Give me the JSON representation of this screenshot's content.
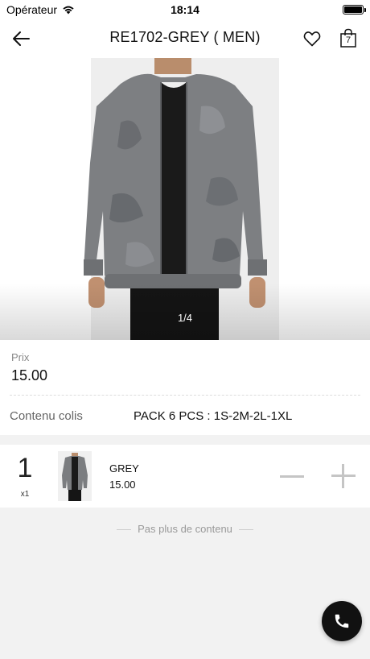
{
  "status_bar": {
    "carrier": "Opérateur",
    "time": "18:14"
  },
  "nav": {
    "title": "RE1702-GREY ( MEN)",
    "cart_count": "7"
  },
  "gallery": {
    "pager": "1/4"
  },
  "product": {
    "price_label": "Prix",
    "price": "15.00",
    "contents_label": "Contenu colis",
    "contents_value": "PACK 6 PCS : 1S-2M-2L-1XL"
  },
  "cart_item": {
    "quantity": "1",
    "multiplier": "x1",
    "color": "GREY",
    "price": "15.00"
  },
  "footer": {
    "end_text": "Pas plus de contenu"
  },
  "colors": {
    "background": "#f2f2f2",
    "fab": "#111111",
    "stepper": "#c5c5c5"
  },
  "icons": {
    "back": "arrow-left-icon",
    "favorite": "heart-icon",
    "cart": "shopping-bag-icon",
    "call": "phone-icon"
  }
}
